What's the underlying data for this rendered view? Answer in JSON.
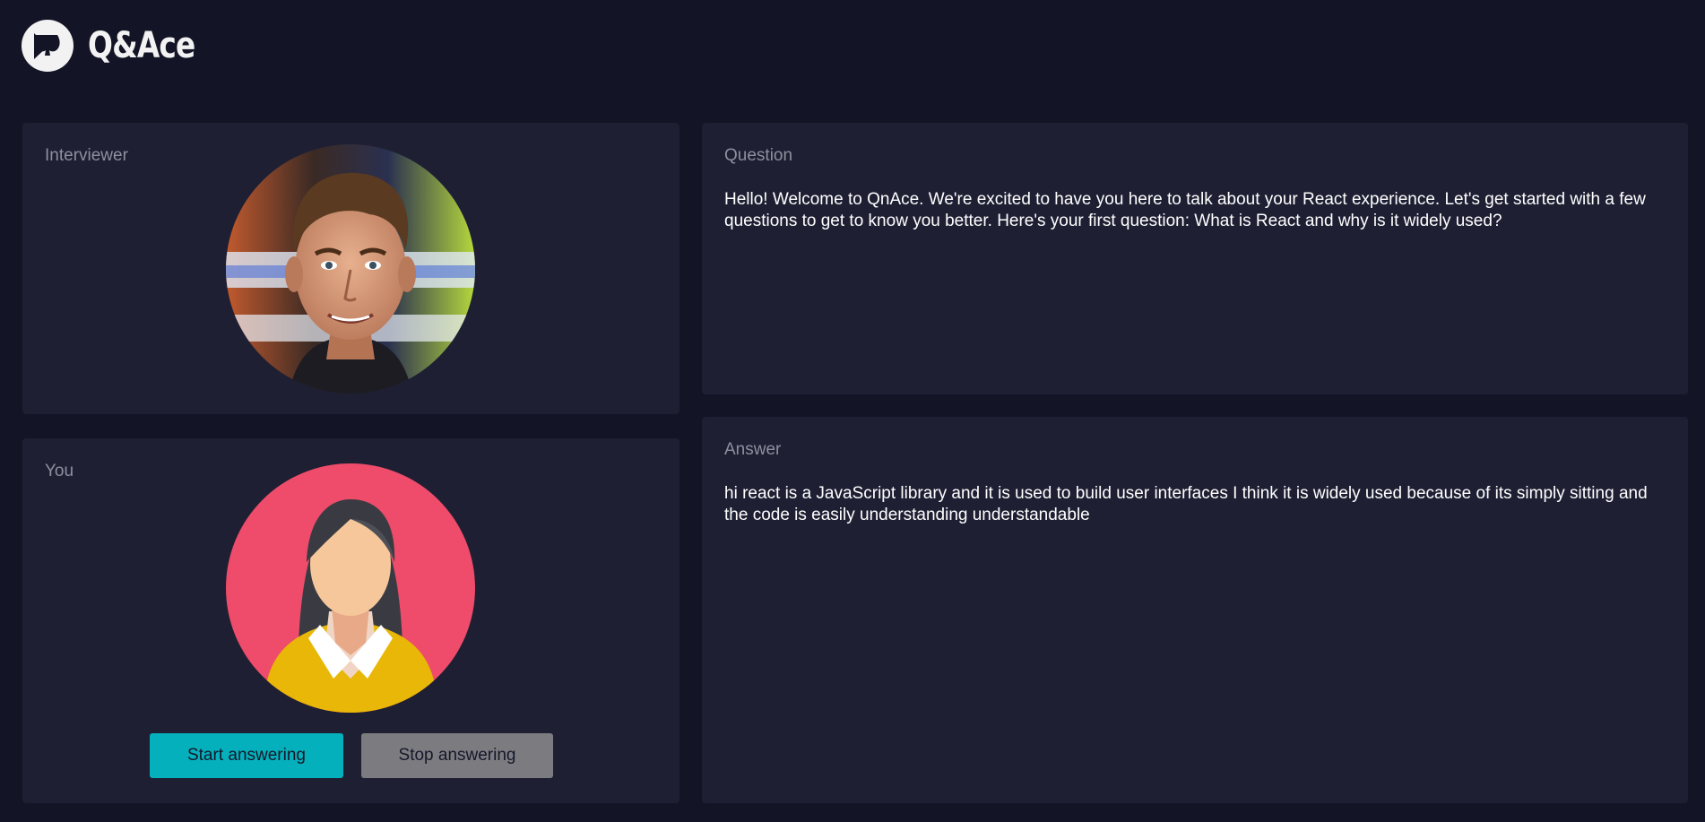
{
  "app": {
    "logo_icon": "spade-icon",
    "name": "Q&Ace"
  },
  "interviewer": {
    "label": "Interviewer",
    "avatar_icon": "interviewer-portrait"
  },
  "you": {
    "label": "You",
    "avatar_icon": "female-user-avatar",
    "start_button": "Start answering",
    "stop_button": "Stop answering"
  },
  "question": {
    "label": "Question",
    "text": "Hello! Welcome to QnAce. We're excited to have you here to talk about your React experience. Let's get started with a few questions to get to know you better. Here's your first question: What is React and why is it widely used?"
  },
  "answer": {
    "label": "Answer",
    "text": "hi react is a JavaScript library and it is used to build user interfaces I think it is widely used because of its simply sitting and the code is easily understanding understandable"
  },
  "colors": {
    "background": "#131426",
    "panel": "#1e1f33",
    "start_button": "#04b0bb",
    "stop_button": "#7c7c80",
    "avatar_you_bg": "#ee4c6a"
  }
}
